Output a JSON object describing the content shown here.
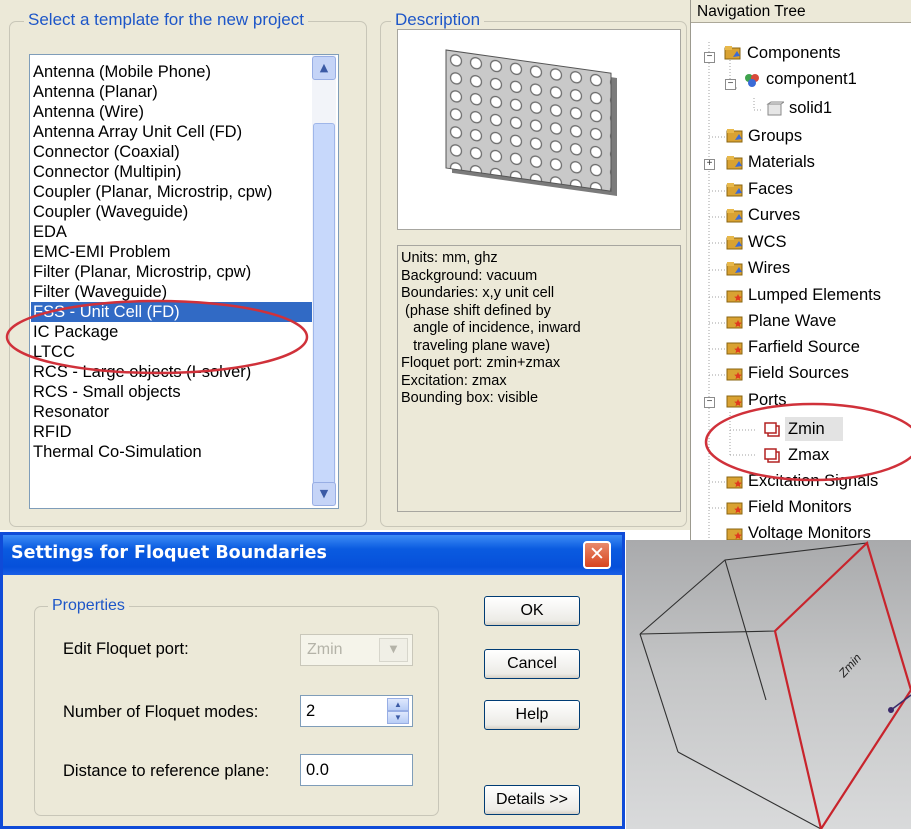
{
  "template_panel": {
    "title": "Select a template for the new project",
    "items": [
      "Antenna (Mobile Phone)",
      "Antenna (Planar)",
      "Antenna (Wire)",
      "Antenna Array Unit Cell (FD)",
      "Connector (Coaxial)",
      "Connector (Multipin)",
      "Coupler (Planar, Microstrip, cpw)",
      "Coupler (Waveguide)",
      "EDA",
      "EMC-EMI Problem",
      "Filter (Planar, Microstrip, cpw)",
      "Filter (Waveguide)",
      "FSS - Unit Cell (FD)",
      "IC Package",
      "LTCC",
      "RCS - Large objects (I-solver)",
      "RCS - Small objects",
      "Resonator",
      "RFID",
      "Thermal Co-Simulation"
    ],
    "selected_item": "FSS - Unit Cell (FD)"
  },
  "description_panel": {
    "title": "Description",
    "lines": [
      "Units: mm, ghz",
      "Background: vacuum",
      "Boundaries: x,y unit cell",
      " (phase shift defined by",
      "   angle of incidence, inward",
      "   traveling plane wave)",
      "Floquet port: zmin+zmax",
      "Excitation: zmax",
      "Bounding box: visible"
    ]
  },
  "navigation_tree": {
    "header": "Navigation Tree",
    "items": {
      "components": "Components",
      "component1": "component1",
      "solid1": "solid1",
      "groups": "Groups",
      "materials": "Materials",
      "faces": "Faces",
      "curves": "Curves",
      "wcs": "WCS",
      "wires": "Wires",
      "lumped_elements": "Lumped Elements",
      "plane_wave": "Plane Wave",
      "farfield_source": "Farfield Source",
      "field_sources": "Field Sources",
      "ports": "Ports",
      "zmin": "Zmin",
      "zmax": "Zmax",
      "excitation_signals": "Excitation Signals",
      "field_monitors": "Field Monitors",
      "voltage_monitors": "Voltage Monitors"
    }
  },
  "dialog": {
    "title": "Settings for Floquet Boundaries",
    "close_symbol": "✕",
    "group_title": "Properties",
    "edit_port_label": "Edit Floquet port:",
    "edit_port_value": "Zmin",
    "modes_label": "Number of Floquet modes:",
    "modes_value": "2",
    "distance_label": "Distance to reference plane:",
    "distance_value": "0.0",
    "ok_label": "OK",
    "cancel_label": "Cancel",
    "help_label": "Help",
    "details_label": "Details >>"
  },
  "view3d": {
    "face_label": "Zmin"
  },
  "colors": {
    "selection": "#316ac5",
    "annotation_ellipse": "#d0313a",
    "xp_title_blue": "#0650da",
    "group_title_blue": "#1d56c8"
  },
  "icons": {
    "list_scroll_up": "▲",
    "list_scroll_down": "▼",
    "combo_arrow": "▼",
    "spin_up": "▲",
    "spin_down": "▼",
    "expand": "+",
    "collapse": "−"
  }
}
